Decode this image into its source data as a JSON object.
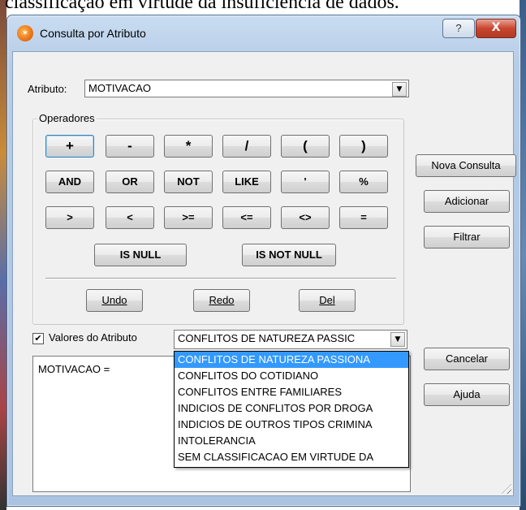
{
  "background_caption": "classificação em virtude da insuficiência de dados.",
  "window": {
    "title": "Consulta por Atributo",
    "help_label": "?",
    "close_label": "X"
  },
  "atributo": {
    "label": "Atributo:",
    "value": "MOTIVACAO"
  },
  "operadores": {
    "group_label": "Operadores",
    "row1": [
      "+",
      "-",
      "*",
      "/",
      "(",
      ")"
    ],
    "row2": [
      "AND",
      "OR",
      "NOT",
      "LIKE",
      "'",
      "%"
    ],
    "row3": [
      ">",
      "<",
      ">=",
      "<=",
      "<>",
      "="
    ],
    "is_null": "IS NULL",
    "is_not_null": "IS NOT NULL",
    "undo": "Undo",
    "redo": "Redo",
    "del": "Del"
  },
  "side_buttons": {
    "nova_consulta": "Nova Consulta",
    "adicionar": "Adicionar",
    "filtrar": "Filtrar",
    "cancelar": "Cancelar",
    "ajuda": "Ajuda"
  },
  "valores": {
    "checkbox_checked": true,
    "checkbox_label": "Valores do Atributo",
    "selected": "CONFLITOS DE NATUREZA PASSIC",
    "options": [
      "CONFLITOS DE NATUREZA PASSIONA",
      "CONFLITOS DO COTIDIANO",
      "CONFLITOS ENTRE FAMILIARES",
      "INDICIOS DE CONFLITOS POR DROGA",
      "INDICIOS DE OUTROS TIPOS CRIMINA",
      "INTOLERANCIA",
      "SEM CLASSIFICACAO EM VIRTUDE DA"
    ]
  },
  "expression": "MOTIVACAO =",
  "colors": {
    "highlight": "#3399ff",
    "close_button": "#c8462f",
    "title_bar": "#c9dcf1"
  }
}
